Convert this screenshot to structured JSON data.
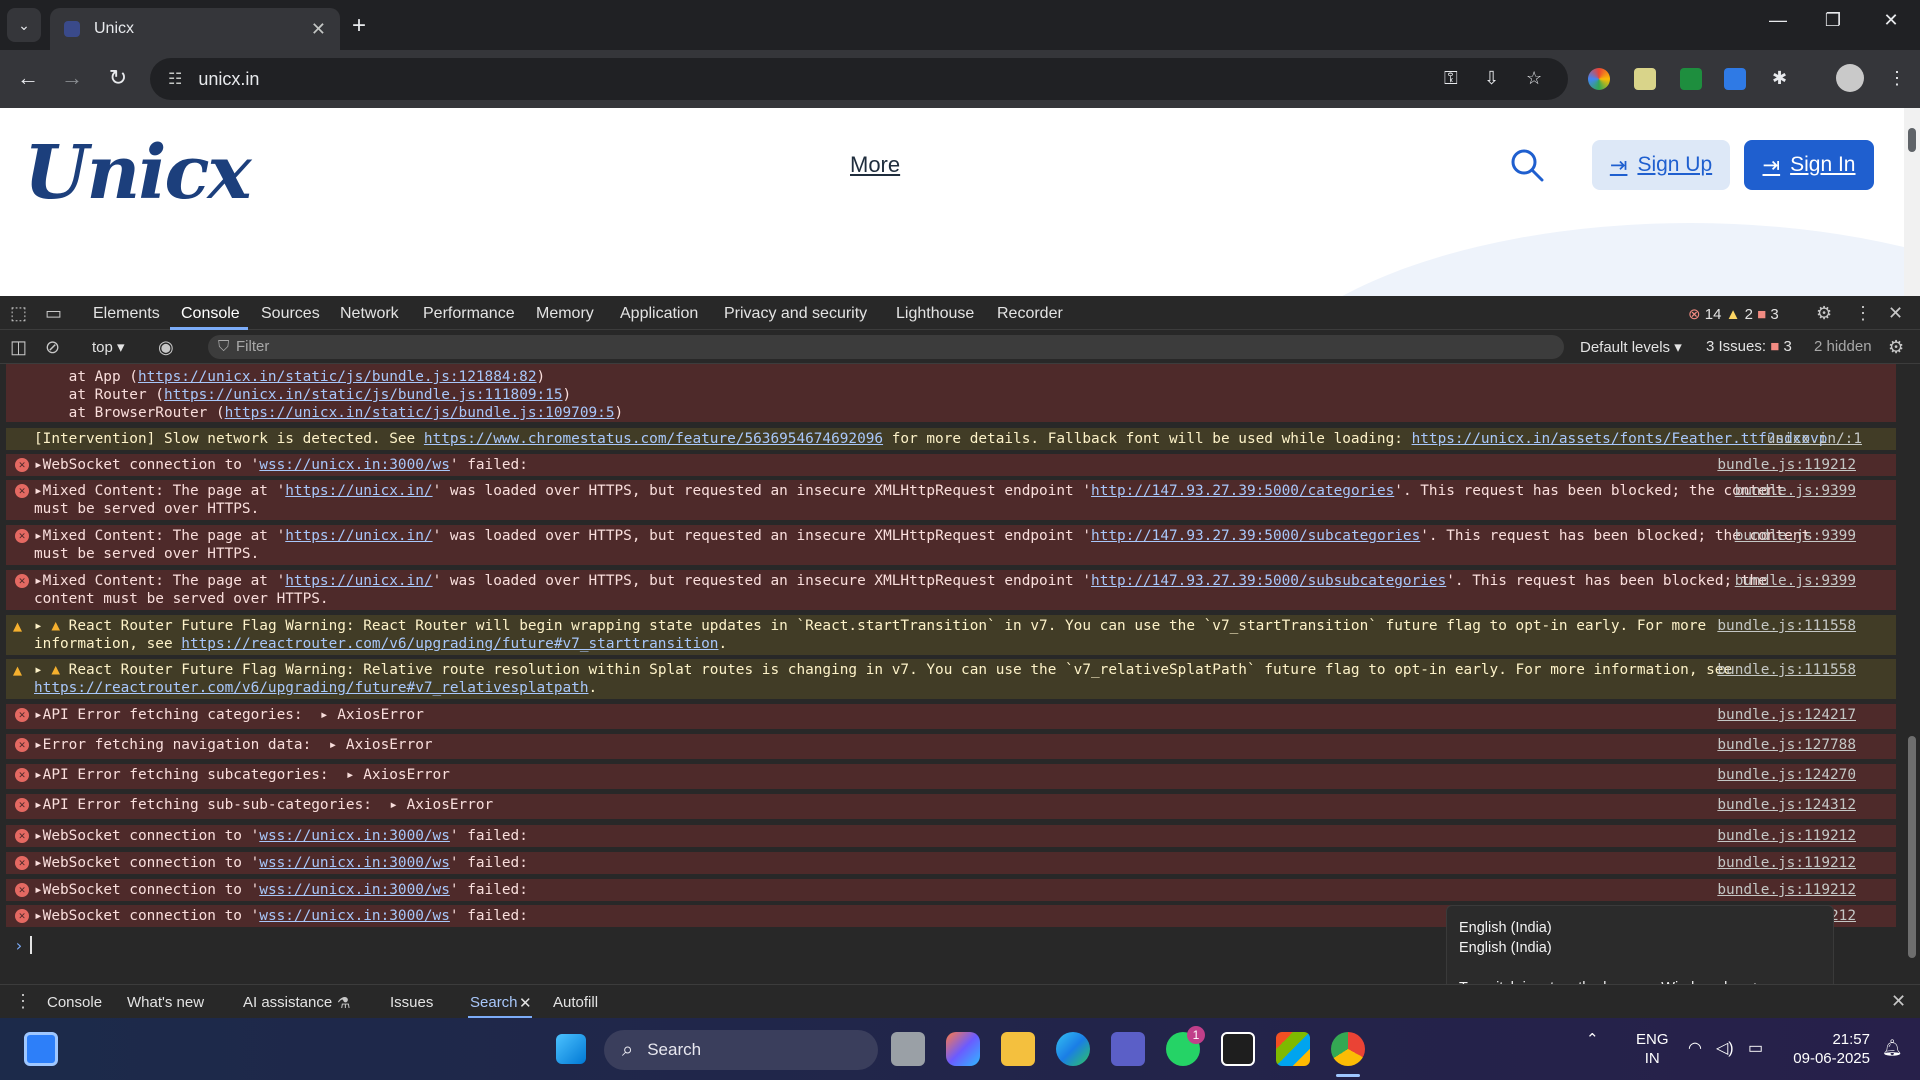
{
  "browser": {
    "tab_title": "Unicx",
    "url": "unicx.in"
  },
  "page": {
    "logo_text": "Unicx",
    "nav_more": "More",
    "signup": "Sign Up",
    "signin": "Sign In"
  },
  "devtools": {
    "tabs": [
      "Elements",
      "Console",
      "Sources",
      "Network",
      "Performance",
      "Memory",
      "Application",
      "Privacy and security",
      "Lighthouse",
      "Recorder"
    ],
    "counts": {
      "errors": "14",
      "warnings": "2",
      "issues": "3"
    },
    "context": "top",
    "filter_placeholder": "Filter",
    "levels": "Default levels",
    "issues_label": "3 Issues:",
    "issues_num": "3",
    "hidden": "2 hidden",
    "stack_lines": [
      {
        "prefix": "    at App (",
        "link": "https://unicx.in/static/js/bundle.js:121884:82",
        "suffix": ")"
      },
      {
        "prefix": "    at Router (",
        "link": "https://unicx.in/static/js/bundle.js:111809:15",
        "suffix": ")"
      },
      {
        "prefix": "    at BrowserRouter (",
        "link": "https://unicx.in/static/js/bundle.js:109709:5",
        "suffix": ")"
      }
    ],
    "intervention": {
      "a": "[Intervention] Slow network is detected. See ",
      "link1": "https://www.chromestatus.com/feature/5636954674692096",
      "b": " for more details. Fallback font will be used while loading: ",
      "link2": "https://unicx.in/assets/fonts/Feather.ttf?sdxovp",
      "src": "unicx.in/:1"
    },
    "ws_prefix": "WebSocket connection to '",
    "ws_link": "wss://unicx.in:3000/ws",
    "ws_suffix": "' failed:",
    "src_ws": "bundle.js:119212",
    "mixed": [
      {
        "a": "Mixed Content: The page at '",
        "page": "https://unicx.in/",
        "b": "' was loaded over HTTPS, but requested an insecure XMLHttpRequest endpoint '",
        "ep": "http://147.93.27.39:5000/categories",
        "c": "'. This request has been blocked; the content",
        "d": "must be served over HTTPS.",
        "src": "bundle.js:9399"
      },
      {
        "a": "Mixed Content: The page at '",
        "page": "https://unicx.in/",
        "b": "' was loaded over HTTPS, but requested an insecure XMLHttpRequest endpoint '",
        "ep": "http://147.93.27.39:5000/subcategories",
        "c": "'. This request has been blocked; the content",
        "d": "must be served over HTTPS.",
        "src": "bundle.js:9399"
      },
      {
        "a": "Mixed Content: The page at '",
        "page": "https://unicx.in/",
        "b": "' was loaded over HTTPS, but requested an insecure XMLHttpRequest endpoint '",
        "ep": "http://147.93.27.39:5000/subsubcategories",
        "c": "'. This request has been blocked; the",
        "d": "content must be served over HTTPS.",
        "src": "bundle.js:9399"
      }
    ],
    "warn1": {
      "a": "React Router Future Flag Warning: React Router will begin wrapping state updates in `React.startTransition` in v7. You can use the `v7_startTransition` future flag to opt-in early. For more",
      "b": "information, see ",
      "link": "https://reactrouter.com/v6/upgrading/future#v7_starttransition",
      "c": ".",
      "src": "bundle.js:111558"
    },
    "warn2": {
      "a": "React Router Future Flag Warning: Relative route resolution within Splat routes is changing in v7. You can use the `v7_relativeSplatPath` future flag to opt-in early. For more information, see",
      "link": "https://reactrouter.com/v6/upgrading/future#v7_relativesplatpath",
      "c": ".",
      "src": "bundle.js:111558"
    },
    "api_errors": [
      {
        "label": "API Error fetching categories:",
        "obj": "AxiosError",
        "src": "bundle.js:124217"
      },
      {
        "label": "Error fetching navigation data:",
        "obj": "AxiosError",
        "src": "bundle.js:127788"
      },
      {
        "label": "API Error fetching subcategories:",
        "obj": "AxiosError",
        "src": "bundle.js:124270"
      },
      {
        "label": "API Error fetching sub-sub-categories:",
        "obj": "AxiosError",
        "src": "bundle.js:124312"
      }
    ],
    "drawer_tabs": [
      "Console",
      "What's new",
      "AI assistance",
      "Issues",
      "Search",
      "Autofill"
    ]
  },
  "ime_tooltip": {
    "line1": "English (India)",
    "line2": "English (India)",
    "hint": "To switch input methods, press Windows key + space."
  },
  "taskbar": {
    "search": "Search",
    "lang_top": "ENG",
    "lang_bottom": "IN",
    "time": "21:57",
    "date": "09-06-2025",
    "whatsapp_badge": "1"
  },
  "colors": {
    "accent_blue": "#1f5fcf",
    "error_bg": "#4e2a2a",
    "warn_bg": "#413c26"
  }
}
